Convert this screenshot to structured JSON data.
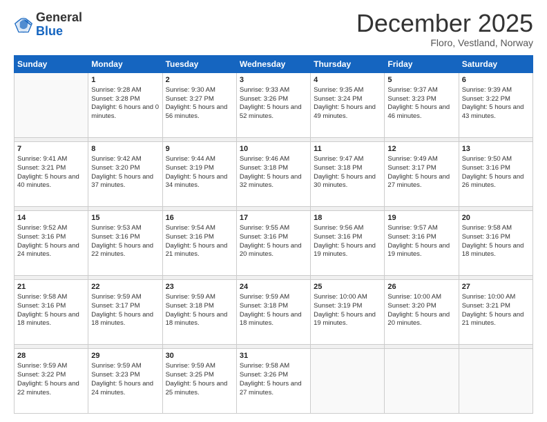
{
  "header": {
    "logo_general": "General",
    "logo_blue": "Blue",
    "month": "December 2025",
    "location": "Floro, Vestland, Norway"
  },
  "weekdays": [
    "Sunday",
    "Monday",
    "Tuesday",
    "Wednesday",
    "Thursday",
    "Friday",
    "Saturday"
  ],
  "weeks": [
    [
      {
        "day": "",
        "sunrise": "",
        "sunset": "",
        "daylight": ""
      },
      {
        "day": "1",
        "sunrise": "9:28 AM",
        "sunset": "3:28 PM",
        "daylight": "6 hours and 0 minutes."
      },
      {
        "day": "2",
        "sunrise": "9:30 AM",
        "sunset": "3:27 PM",
        "daylight": "5 hours and 56 minutes."
      },
      {
        "day": "3",
        "sunrise": "9:33 AM",
        "sunset": "3:26 PM",
        "daylight": "5 hours and 52 minutes."
      },
      {
        "day": "4",
        "sunrise": "9:35 AM",
        "sunset": "3:24 PM",
        "daylight": "5 hours and 49 minutes."
      },
      {
        "day": "5",
        "sunrise": "9:37 AM",
        "sunset": "3:23 PM",
        "daylight": "5 hours and 46 minutes."
      },
      {
        "day": "6",
        "sunrise": "9:39 AM",
        "sunset": "3:22 PM",
        "daylight": "5 hours and 43 minutes."
      }
    ],
    [
      {
        "day": "7",
        "sunrise": "9:41 AM",
        "sunset": "3:21 PM",
        "daylight": "5 hours and 40 minutes."
      },
      {
        "day": "8",
        "sunrise": "9:42 AM",
        "sunset": "3:20 PM",
        "daylight": "5 hours and 37 minutes."
      },
      {
        "day": "9",
        "sunrise": "9:44 AM",
        "sunset": "3:19 PM",
        "daylight": "5 hours and 34 minutes."
      },
      {
        "day": "10",
        "sunrise": "9:46 AM",
        "sunset": "3:18 PM",
        "daylight": "5 hours and 32 minutes."
      },
      {
        "day": "11",
        "sunrise": "9:47 AM",
        "sunset": "3:18 PM",
        "daylight": "5 hours and 30 minutes."
      },
      {
        "day": "12",
        "sunrise": "9:49 AM",
        "sunset": "3:17 PM",
        "daylight": "5 hours and 27 minutes."
      },
      {
        "day": "13",
        "sunrise": "9:50 AM",
        "sunset": "3:16 PM",
        "daylight": "5 hours and 26 minutes."
      }
    ],
    [
      {
        "day": "14",
        "sunrise": "9:52 AM",
        "sunset": "3:16 PM",
        "daylight": "5 hours and 24 minutes."
      },
      {
        "day": "15",
        "sunrise": "9:53 AM",
        "sunset": "3:16 PM",
        "daylight": "5 hours and 22 minutes."
      },
      {
        "day": "16",
        "sunrise": "9:54 AM",
        "sunset": "3:16 PM",
        "daylight": "5 hours and 21 minutes."
      },
      {
        "day": "17",
        "sunrise": "9:55 AM",
        "sunset": "3:16 PM",
        "daylight": "5 hours and 20 minutes."
      },
      {
        "day": "18",
        "sunrise": "9:56 AM",
        "sunset": "3:16 PM",
        "daylight": "5 hours and 19 minutes."
      },
      {
        "day": "19",
        "sunrise": "9:57 AM",
        "sunset": "3:16 PM",
        "daylight": "5 hours and 19 minutes."
      },
      {
        "day": "20",
        "sunrise": "9:58 AM",
        "sunset": "3:16 PM",
        "daylight": "5 hours and 18 minutes."
      }
    ],
    [
      {
        "day": "21",
        "sunrise": "9:58 AM",
        "sunset": "3:16 PM",
        "daylight": "5 hours and 18 minutes."
      },
      {
        "day": "22",
        "sunrise": "9:59 AM",
        "sunset": "3:17 PM",
        "daylight": "5 hours and 18 minutes."
      },
      {
        "day": "23",
        "sunrise": "9:59 AM",
        "sunset": "3:18 PM",
        "daylight": "5 hours and 18 minutes."
      },
      {
        "day": "24",
        "sunrise": "9:59 AM",
        "sunset": "3:18 PM",
        "daylight": "5 hours and 18 minutes."
      },
      {
        "day": "25",
        "sunrise": "10:00 AM",
        "sunset": "3:19 PM",
        "daylight": "5 hours and 19 minutes."
      },
      {
        "day": "26",
        "sunrise": "10:00 AM",
        "sunset": "3:20 PM",
        "daylight": "5 hours and 20 minutes."
      },
      {
        "day": "27",
        "sunrise": "10:00 AM",
        "sunset": "3:21 PM",
        "daylight": "5 hours and 21 minutes."
      }
    ],
    [
      {
        "day": "28",
        "sunrise": "9:59 AM",
        "sunset": "3:22 PM",
        "daylight": "5 hours and 22 minutes."
      },
      {
        "day": "29",
        "sunrise": "9:59 AM",
        "sunset": "3:23 PM",
        "daylight": "5 hours and 24 minutes."
      },
      {
        "day": "30",
        "sunrise": "9:59 AM",
        "sunset": "3:25 PM",
        "daylight": "5 hours and 25 minutes."
      },
      {
        "day": "31",
        "sunrise": "9:58 AM",
        "sunset": "3:26 PM",
        "daylight": "5 hours and 27 minutes."
      },
      {
        "day": "",
        "sunrise": "",
        "sunset": "",
        "daylight": ""
      },
      {
        "day": "",
        "sunrise": "",
        "sunset": "",
        "daylight": ""
      },
      {
        "day": "",
        "sunrise": "",
        "sunset": "",
        "daylight": ""
      }
    ]
  ]
}
